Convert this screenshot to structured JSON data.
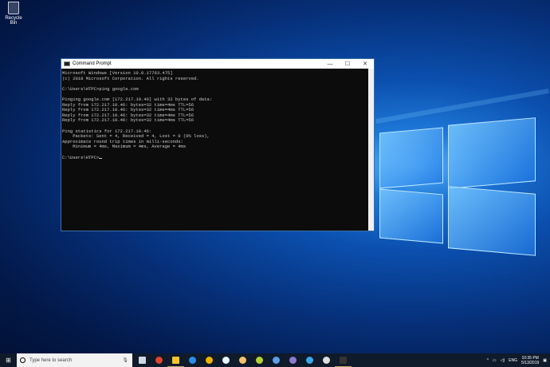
{
  "desktop": {
    "recycle_bin_label": "Recycle Bin"
  },
  "window": {
    "title": "Command Prompt",
    "minimize": "—",
    "maximize": "☐",
    "close": "✕",
    "lines": [
      "Microsoft Windows [Version 10.0.17763.475]",
      "(c) 2018 Microsoft Corporation. All rights reserved.",
      "",
      "C:\\Users\\HTPC>ping google.com",
      "",
      "Pinging google.com [172.217.10.46] with 32 bytes of data:",
      "Reply from 172.217.10.46: bytes=32 time=4ms TTL=56",
      "Reply from 172.217.10.46: bytes=32 time=4ms TTL=56",
      "Reply from 172.217.10.46: bytes=32 time=4ms TTL=56",
      "Reply from 172.217.10.46: bytes=32 time=4ms TTL=56",
      "",
      "Ping statistics for 172.217.10.46:",
      "    Packets: Sent = 4, Received = 4, Lost = 0 (0% loss),",
      "Approximate round trip times in milli-seconds:",
      "    Minimum = 4ms, Maximum = 4ms, Average = 4ms",
      ""
    ],
    "prompt": "C:\\Users\\HTPC>"
  },
  "taskbar": {
    "search_placeholder": "Type here to search",
    "apps": [
      {
        "name": "task-view",
        "color": "#cfd8e3"
      },
      {
        "name": "chrome",
        "color": "#e0452f"
      },
      {
        "name": "file-explorer",
        "color": "#f4c430"
      },
      {
        "name": "app-blue",
        "color": "#2a8ee8"
      },
      {
        "name": "app-yellow",
        "color": "#f0b400"
      },
      {
        "name": "app-lifebuoy",
        "color": "#e8f4ff"
      },
      {
        "name": "app-lifebuoy-orange",
        "color": "#f5c26b"
      },
      {
        "name": "app-green",
        "color": "#b5d334"
      },
      {
        "name": "app-drop",
        "color": "#5aa0e8"
      },
      {
        "name": "app-purple",
        "color": "#8a7ad0"
      },
      {
        "name": "app-kodi",
        "color": "#3aa7e8"
      },
      {
        "name": "app-download",
        "color": "#dddddd"
      },
      {
        "name": "command-prompt",
        "color": "#333333"
      }
    ],
    "language": "ENG",
    "time": "10:35 PM",
    "date": "5/13/2019"
  }
}
